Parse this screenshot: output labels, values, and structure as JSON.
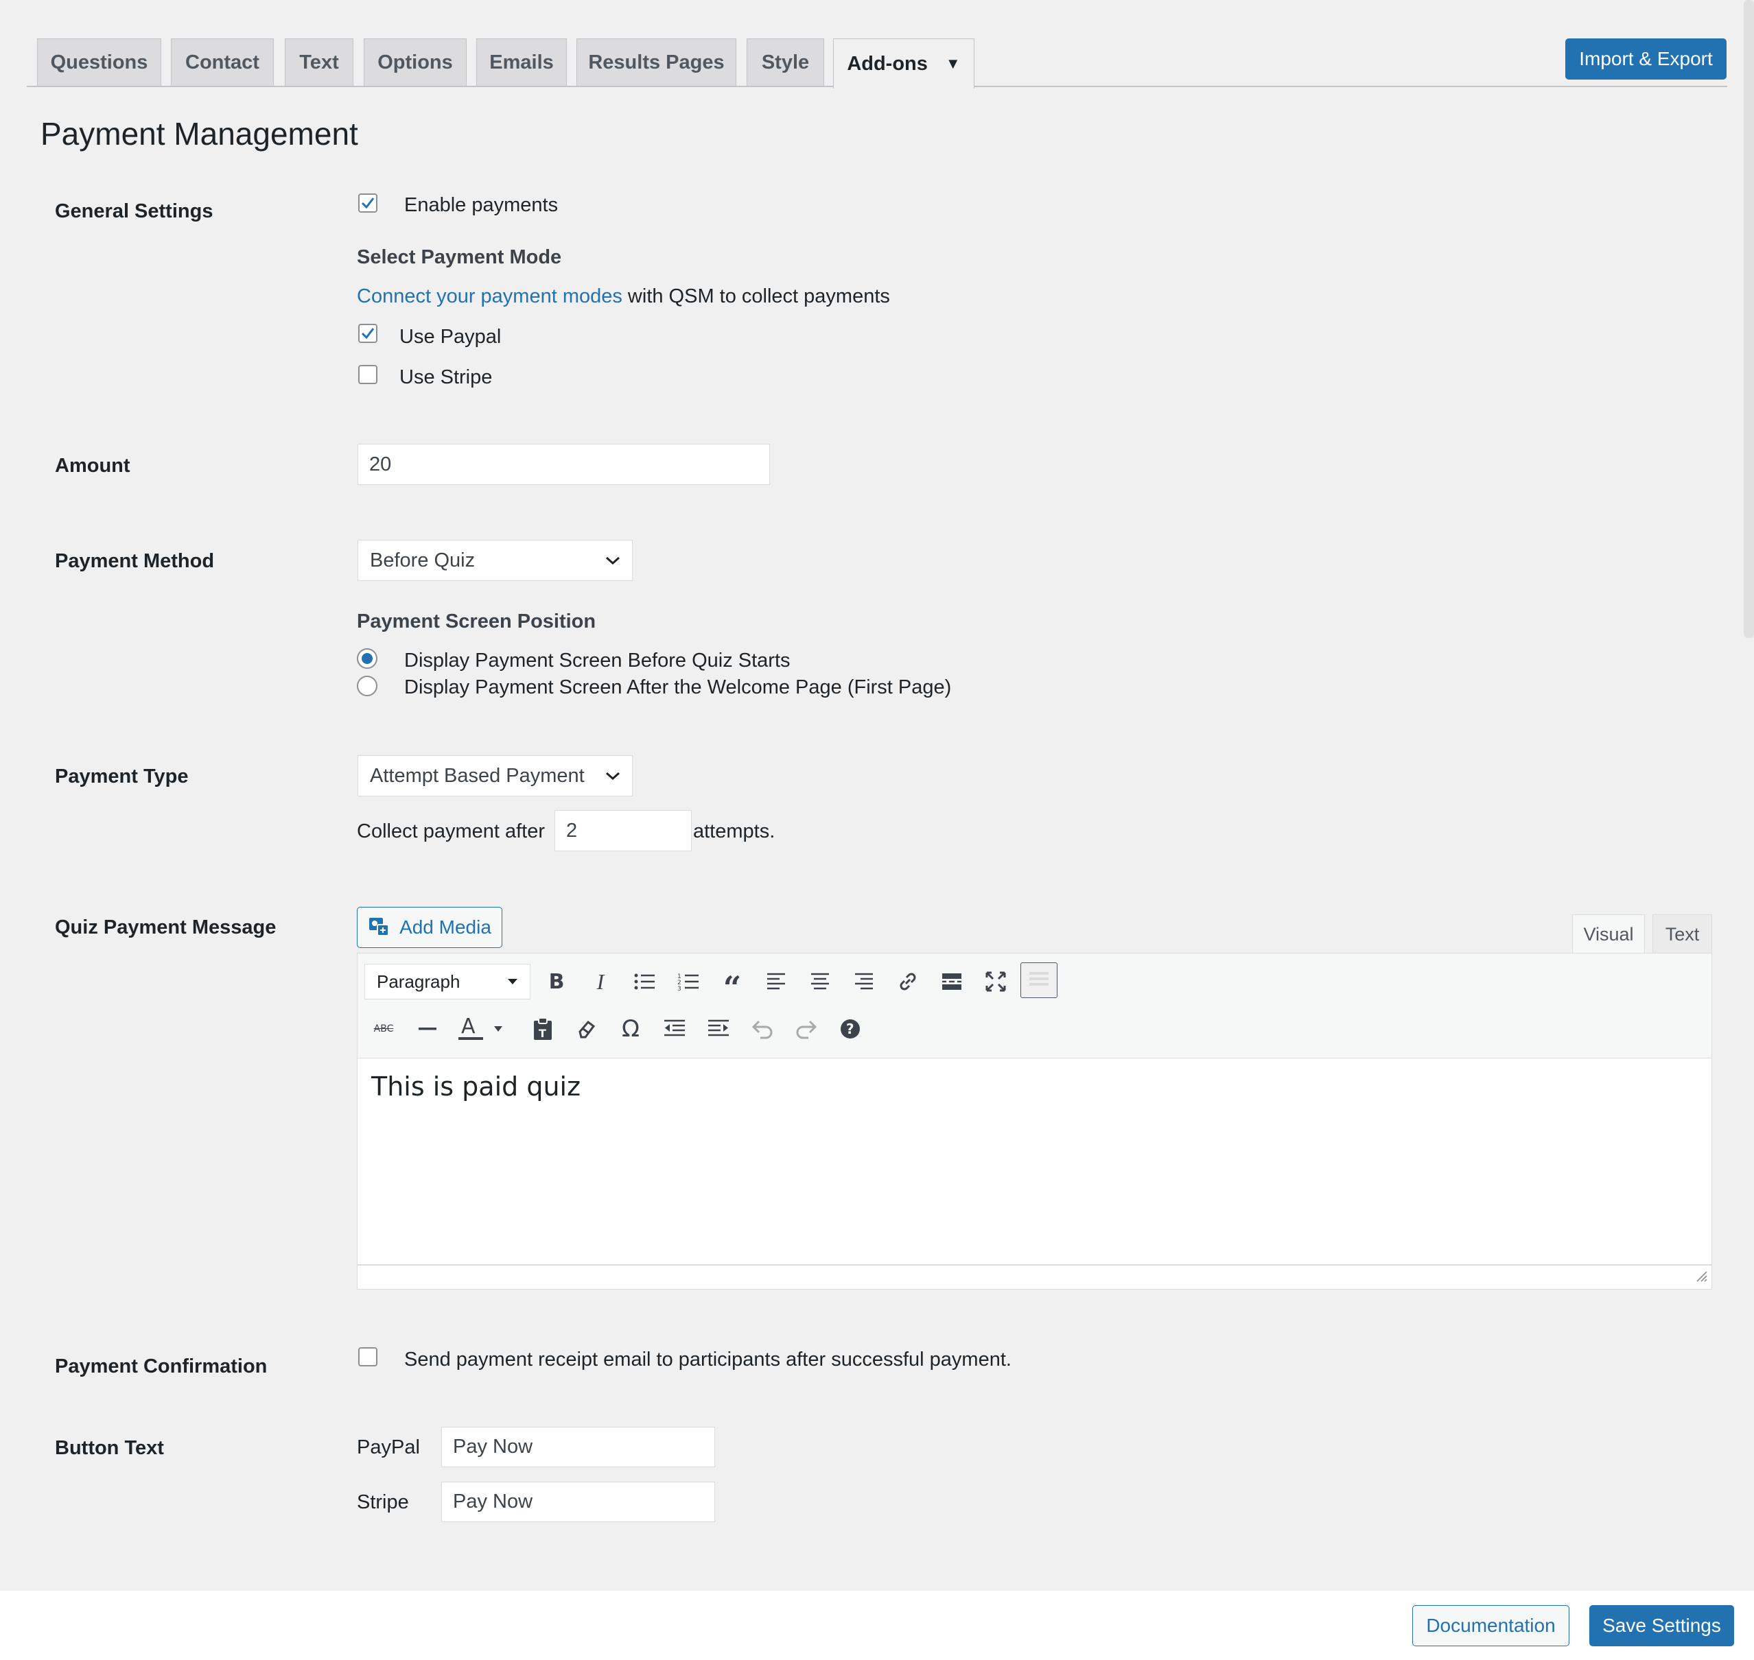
{
  "tabs": [
    {
      "label": "Questions"
    },
    {
      "label": "Contact"
    },
    {
      "label": "Text"
    },
    {
      "label": "Options"
    },
    {
      "label": "Emails"
    },
    {
      "label": "Results Pages"
    },
    {
      "label": "Style"
    },
    {
      "label": "Add-ons"
    }
  ],
  "import_export_label": "Import & Export",
  "page_title": "Payment Management",
  "general": {
    "label": "General Settings",
    "enable_payments": {
      "label": "Enable payments",
      "checked": true
    },
    "mode_title": "Select Payment Mode",
    "connect_link": "Connect your payment modes",
    "connect_rest": " with QSM to collect payments",
    "use_paypal": {
      "label": "Use Paypal",
      "checked": true
    },
    "use_stripe": {
      "label": "Use Stripe",
      "checked": false
    }
  },
  "amount": {
    "label": "Amount",
    "value": "20"
  },
  "payment_method": {
    "label": "Payment Method",
    "selected": "Before Quiz",
    "position_title": "Payment Screen Position",
    "options": [
      {
        "label": "Display Payment Screen Before Quiz Starts",
        "selected": true
      },
      {
        "label": "Display Payment Screen After the Welcome Page (First Page)",
        "selected": false
      }
    ]
  },
  "payment_type": {
    "label": "Payment Type",
    "selected": "Attempt Based Payment",
    "collect_prefix": "Collect payment after",
    "attempts_value": "2",
    "collect_suffix": "attempts."
  },
  "quiz_message": {
    "label": "Quiz Payment Message",
    "add_media": "Add Media",
    "tab_visual": "Visual",
    "tab_text": "Text",
    "format_select": "Paragraph",
    "content": "This is paid quiz"
  },
  "confirmation": {
    "label": "Payment Confirmation",
    "checkbox_label": "Send payment receipt email to participants after successful payment.",
    "checked": false
  },
  "button_text": {
    "label": "Button Text",
    "paypal_label": "PayPal",
    "paypal_value": "Pay Now",
    "stripe_label": "Stripe",
    "stripe_value": "Pay Now"
  },
  "footer": {
    "documentation": "Documentation",
    "save": "Save Settings"
  },
  "colors": {
    "primary": "#2271b1",
    "background": "#f0f0f1"
  }
}
